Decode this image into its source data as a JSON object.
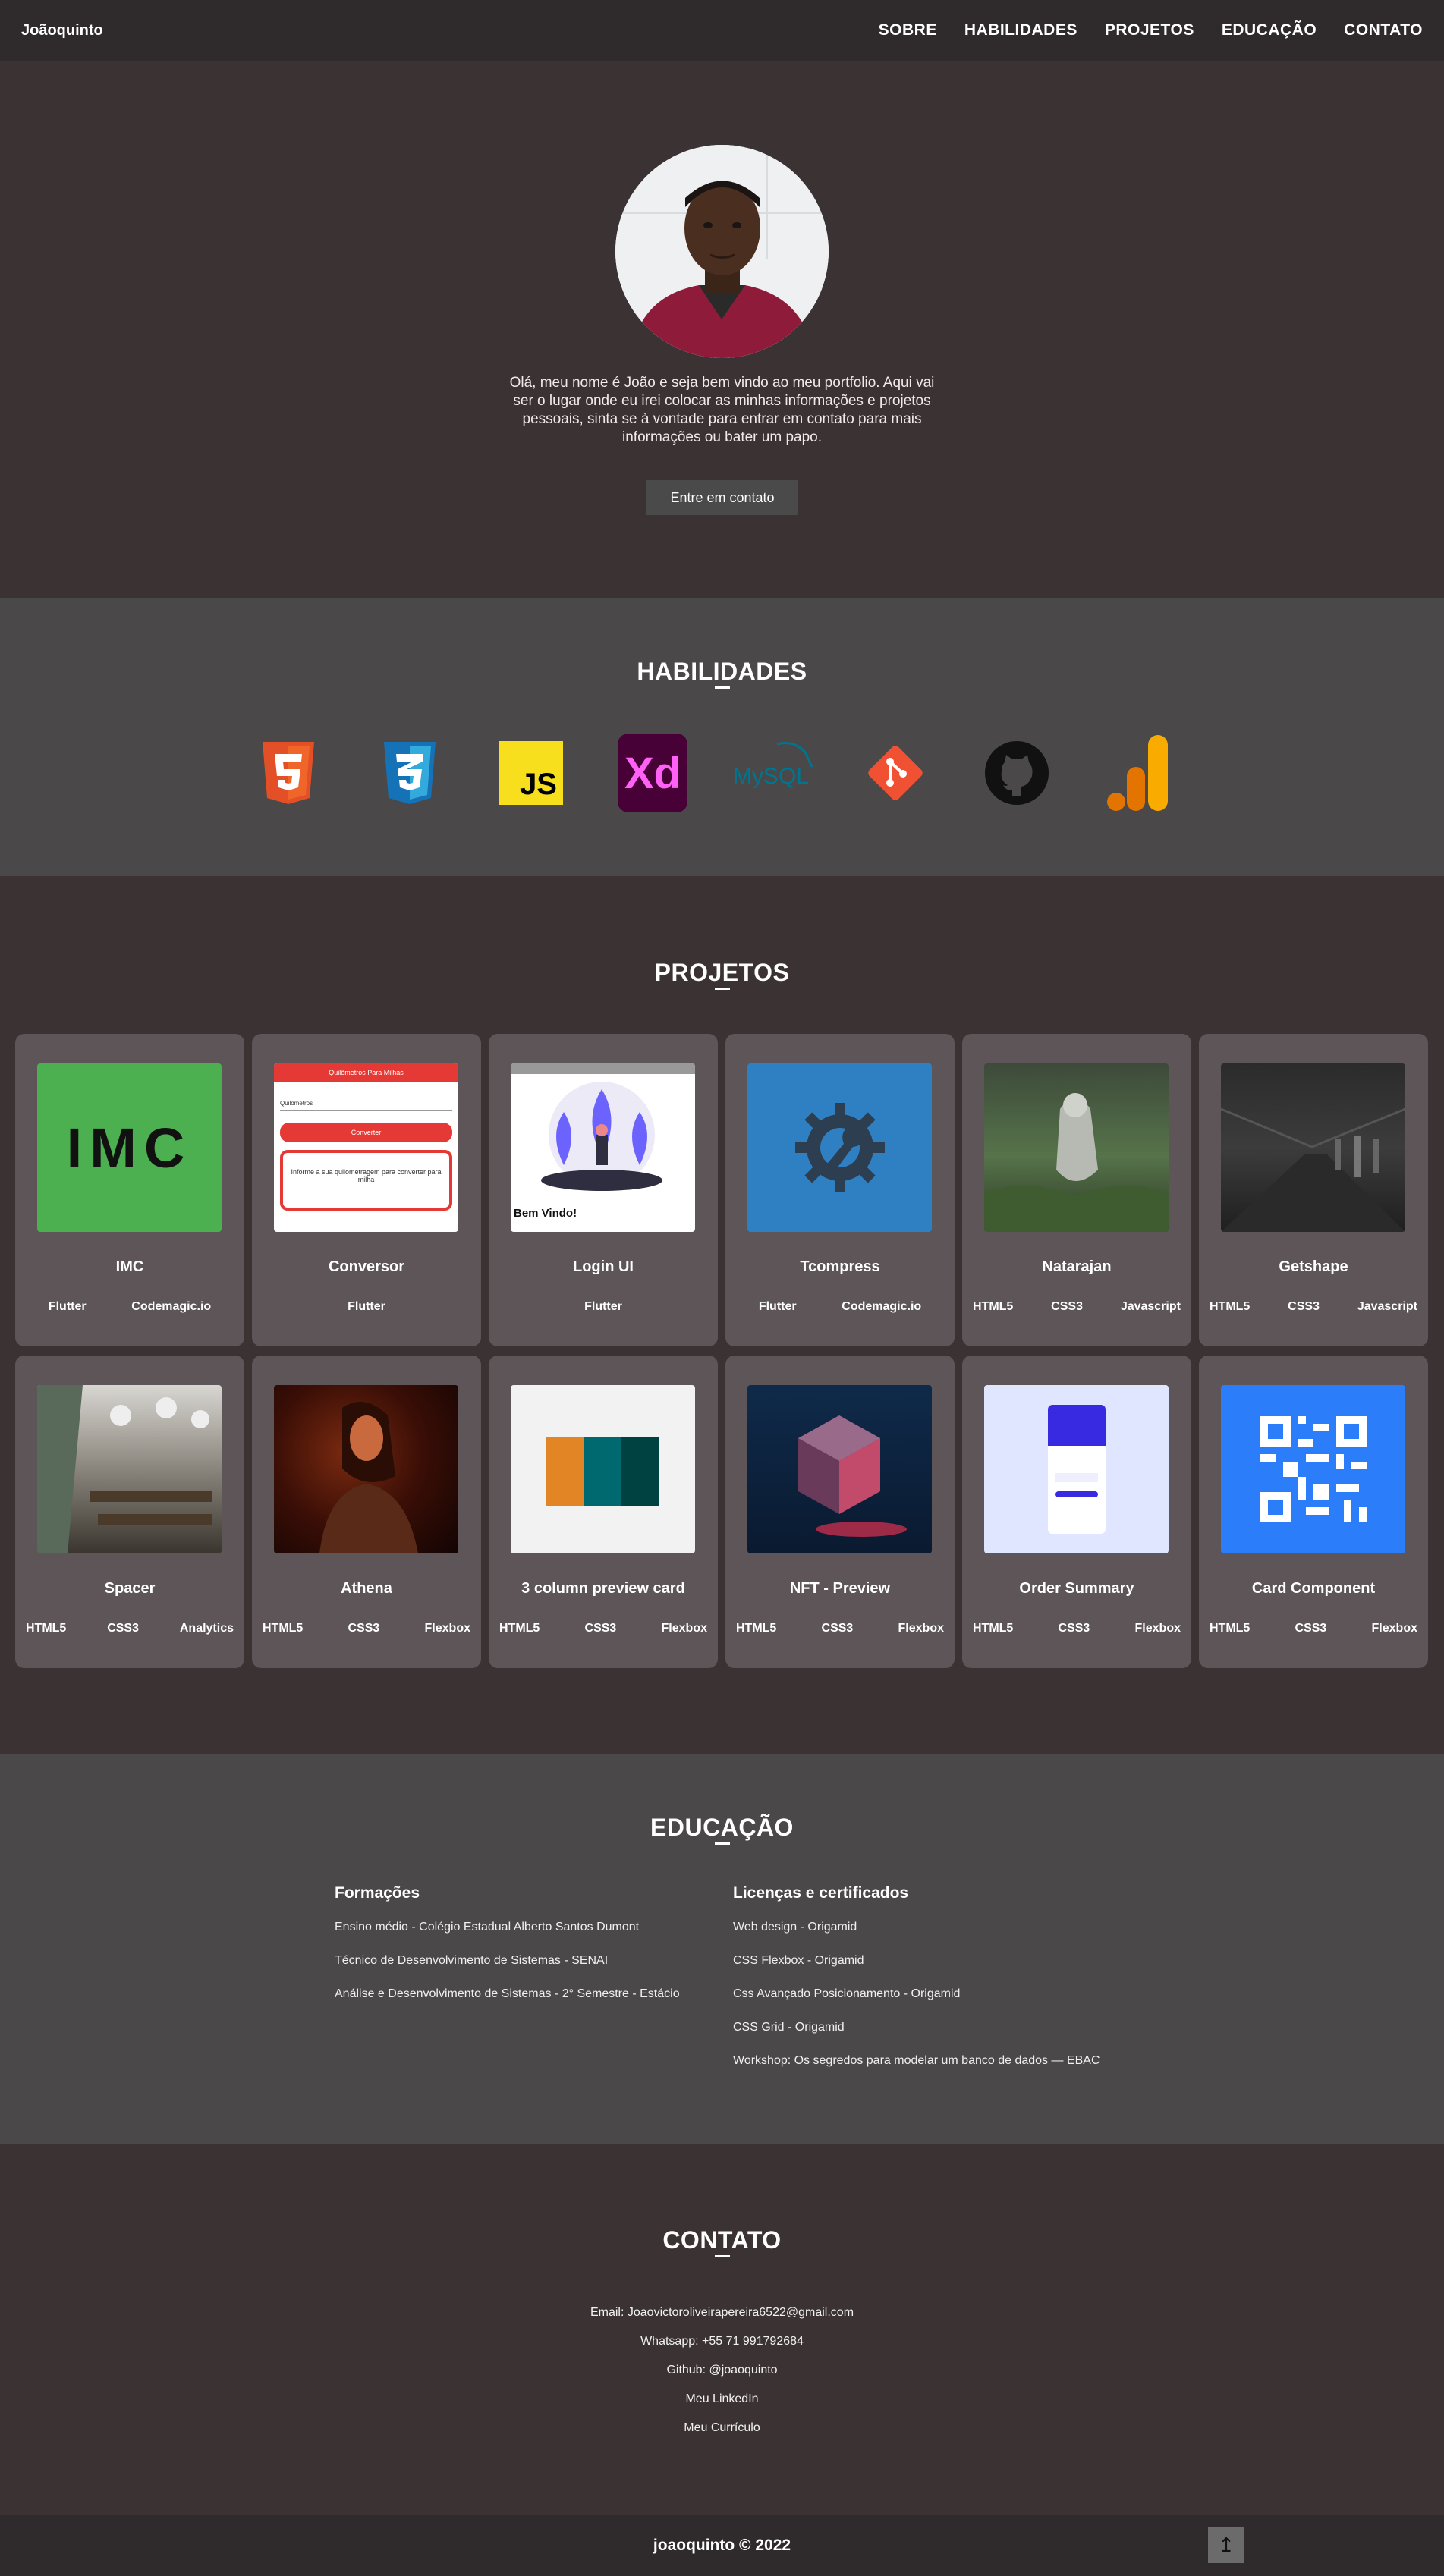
{
  "nav": {
    "brand": "Joãoquinto",
    "items": [
      "SOBRE",
      "HABILIDADES",
      "PROJETOS",
      "EDUCAÇÃO",
      "CONTATO"
    ]
  },
  "hero": {
    "text": "Olá, meu nome é João e seja bem vindo ao meu portfolio. Aqui vai ser o lugar onde eu irei colocar as minhas informações e projetos pessoais, sinta se à vontade para entrar em contato para mais informações ou bater um papo.",
    "cta_label": "Entre em contato"
  },
  "skills": {
    "title": "HABILIDADES",
    "icons": [
      "html5-icon",
      "css3-icon",
      "javascript-icon",
      "adobe-xd-icon",
      "mysql-icon",
      "git-icon",
      "github-icon",
      "analytics-icon"
    ],
    "js_text": "JS",
    "xd_text": "Xd",
    "mysql_text": "MySQL"
  },
  "projects": {
    "title": "PROJETOS",
    "cards": [
      {
        "title": "IMC",
        "tags": [
          "Flutter",
          "Codemagic.io"
        ],
        "thumb_text": "IMC"
      },
      {
        "title": "Conversor",
        "tags": [
          "Flutter"
        ],
        "thumb_header": "Quilômetros Para Milhas",
        "thumb_label": "Quilômetros",
        "thumb_button": "Converter",
        "thumb_msg": "Informe a sua quilometragem para converter para milha"
      },
      {
        "title": "Login UI",
        "tags": [
          "Flutter"
        ],
        "thumb_caption": "Bem Vindo!"
      },
      {
        "title": "Tcompress",
        "tags": [
          "Flutter",
          "Codemagic.io"
        ]
      },
      {
        "title": "Natarajan",
        "tags": [
          "HTML5",
          "CSS3",
          "Javascript"
        ]
      },
      {
        "title": "Getshape",
        "tags": [
          "HTML5",
          "CSS3",
          "Javascript"
        ]
      },
      {
        "title": "Spacer",
        "tags": [
          "HTML5",
          "CSS3",
          "Analytics"
        ]
      },
      {
        "title": "Athena",
        "tags": [
          "HTML5",
          "CSS3",
          "Flexbox"
        ]
      },
      {
        "title": "3 column preview card",
        "tags": [
          "HTML5",
          "CSS3",
          "Flexbox"
        ]
      },
      {
        "title": "NFT - Preview",
        "tags": [
          "HTML5",
          "CSS3",
          "Flexbox"
        ]
      },
      {
        "title": "Order Summary",
        "tags": [
          "HTML5",
          "CSS3",
          "Flexbox"
        ]
      },
      {
        "title": "Card Component",
        "tags": [
          "HTML5",
          "CSS3",
          "Flexbox"
        ]
      }
    ]
  },
  "education": {
    "title": "EDUCAÇÃO",
    "formacoes_title": "Formações",
    "formacoes": [
      "Ensino médio - Colégio Estadual Alberto Santos Dumont",
      "Técnico de Desenvolvimento de Sistemas - SENAI",
      "Análise e Desenvolvimento de Sistemas - 2° Semestre - Estácio"
    ],
    "certificados_title": "Licenças e certificados",
    "certificados": [
      "Web design - Origamid",
      "CSS Flexbox - Origamid",
      "Css Avançado Posicionamento - Origamid",
      "CSS Grid - Origamid",
      "Workshop: Os segredos para modelar um banco de dados — EBAC"
    ]
  },
  "contact": {
    "title": "CONTATO",
    "email": "Email: Joaovictoroliveirapereira6522@gmail.com",
    "whatsapp": "Whatsapp: +55 71 991792684",
    "github": "Github: @joaoquinto",
    "linkedin": "Meu LinkedIn",
    "curriculo": "Meu Currículo"
  },
  "footer": {
    "text": "joaoquinto © 2022",
    "to_top_icon": "arrow-up-icon"
  },
  "colors": {
    "nav_bg": "#2f2a2b",
    "page_bg": "#3b3234",
    "section_alt_bg": "#4a4849",
    "card_bg": "#5d5558"
  }
}
